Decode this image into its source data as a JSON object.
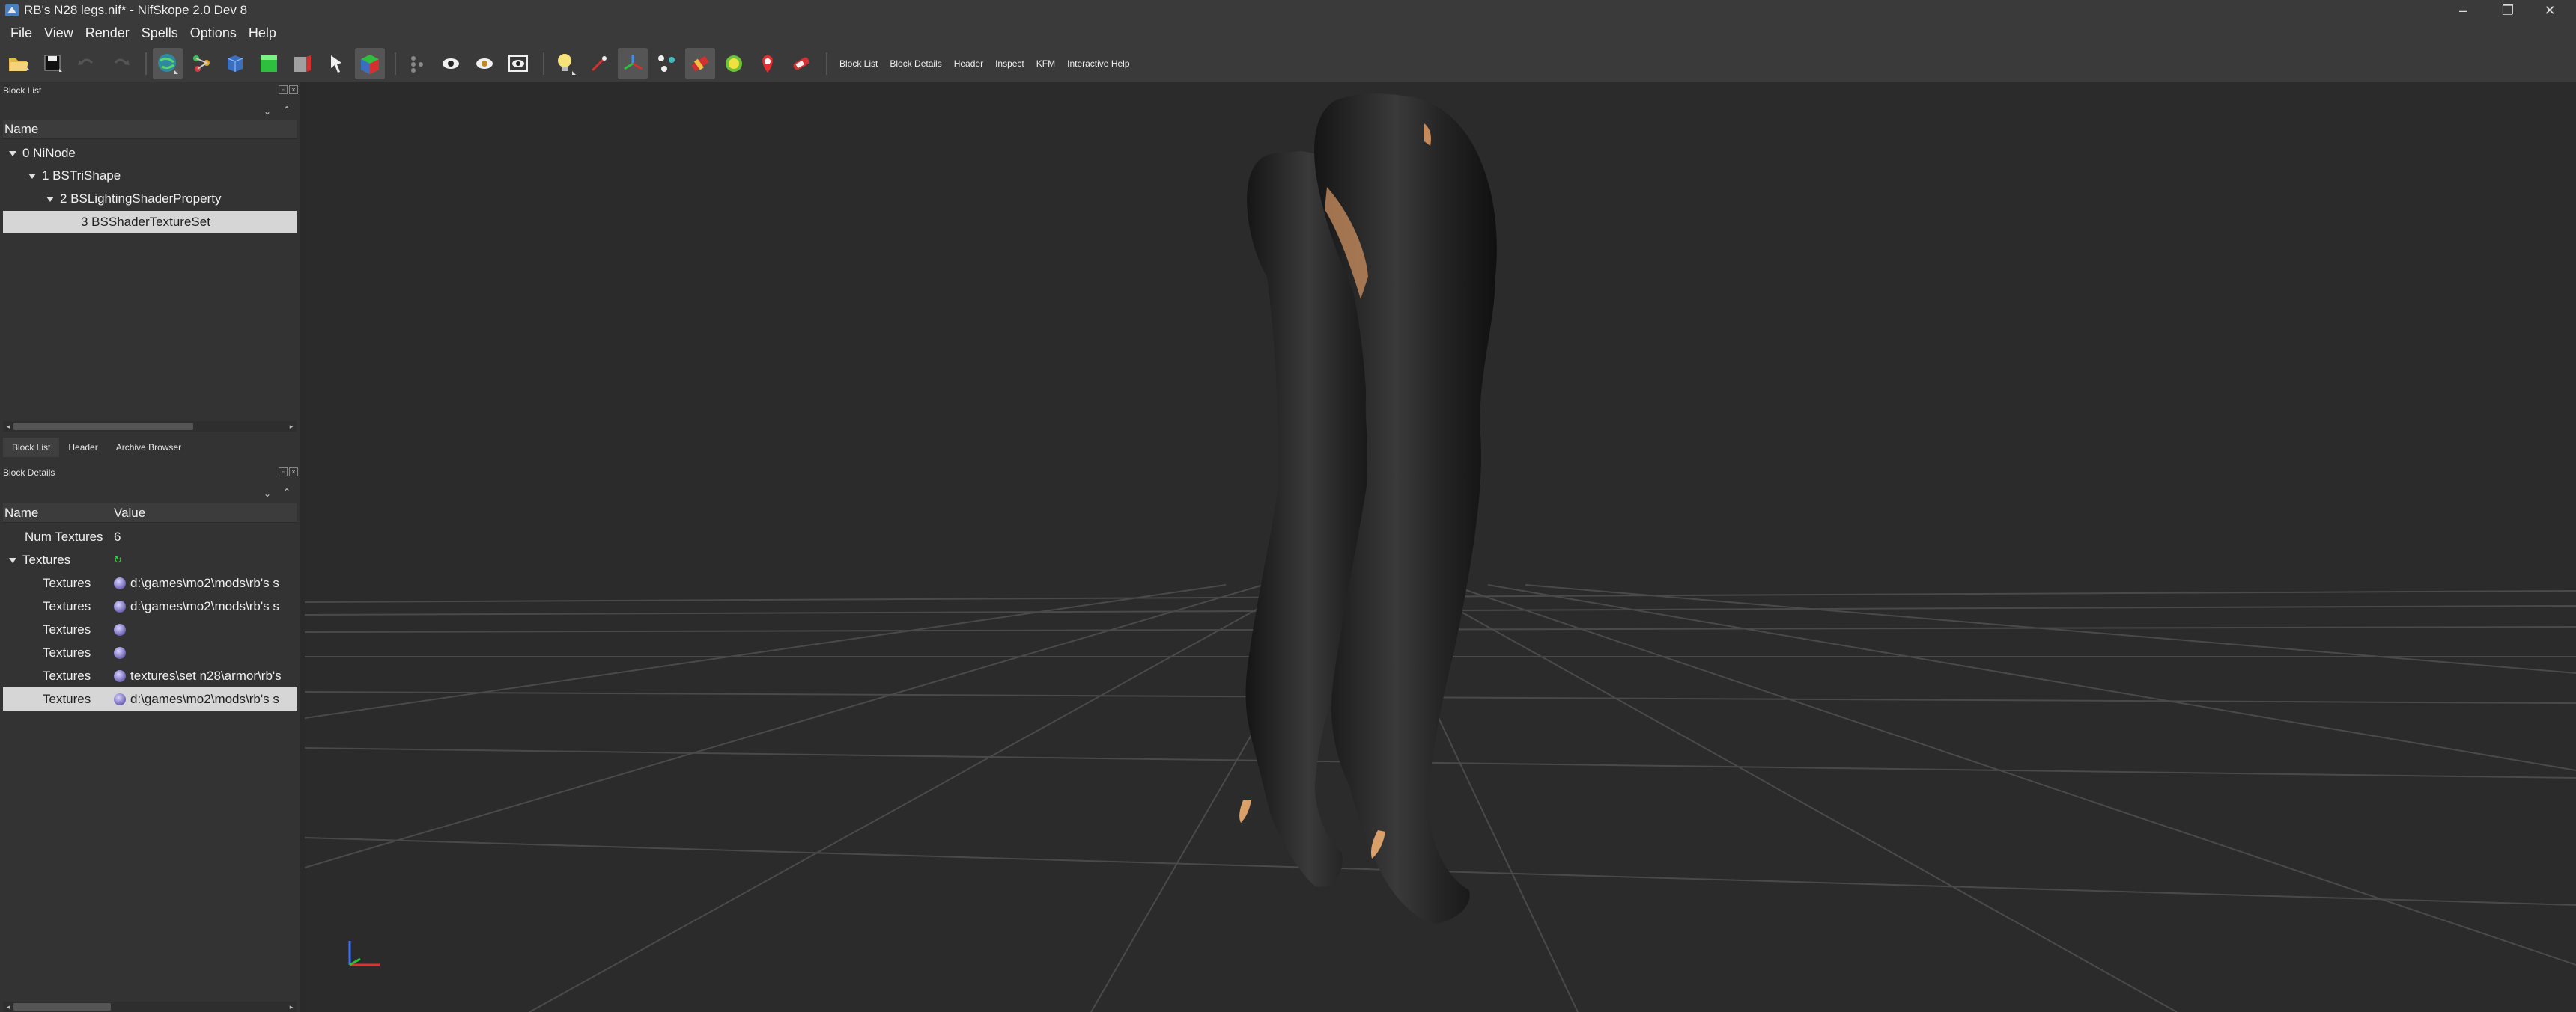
{
  "window": {
    "title": "RB's N28 legs.nif* - NifSkope 2.0 Dev 8",
    "minimize": "–",
    "maximize": "❐",
    "close": "✕"
  },
  "menu": [
    "File",
    "View",
    "Render",
    "Spells",
    "Options",
    "Help"
  ],
  "toolbar": {
    "text_buttons": [
      "Block List",
      "Block Details",
      "Header",
      "Inspect",
      "KFM",
      "Interactive Help"
    ]
  },
  "block_list": {
    "title": "Block List",
    "column": "Name",
    "rows": [
      {
        "label": "0 NiNode"
      },
      {
        "label": "1 BSTriShape"
      },
      {
        "label": "2 BSLightingShaderProperty"
      },
      {
        "label": "3 BSShaderTextureSet"
      }
    ],
    "tabs": [
      "Block List",
      "Header",
      "Archive Browser"
    ]
  },
  "block_details": {
    "title": "Block Details",
    "col_name": "Name",
    "col_value": "Value",
    "rows": [
      {
        "name": "Num Textures",
        "value": "6"
      },
      {
        "name": "Textures",
        "value": ""
      },
      {
        "name": "Textures",
        "value": "d:\\games\\mo2\\mods\\rb's s"
      },
      {
        "name": "Textures",
        "value": "d:\\games\\mo2\\mods\\rb's s"
      },
      {
        "name": "Textures",
        "value": ""
      },
      {
        "name": "Textures",
        "value": ""
      },
      {
        "name": "Textures",
        "value": "textures\\set n28\\armor\\rb's"
      },
      {
        "name": "Textures",
        "value": "d:\\games\\mo2\\mods\\rb's s"
      }
    ]
  },
  "colors": {
    "background": "#2b2b2b",
    "panel": "#333333",
    "selection": "#d6d6d6",
    "grid": "#4a4a4a",
    "model": "#1c1c1c"
  }
}
